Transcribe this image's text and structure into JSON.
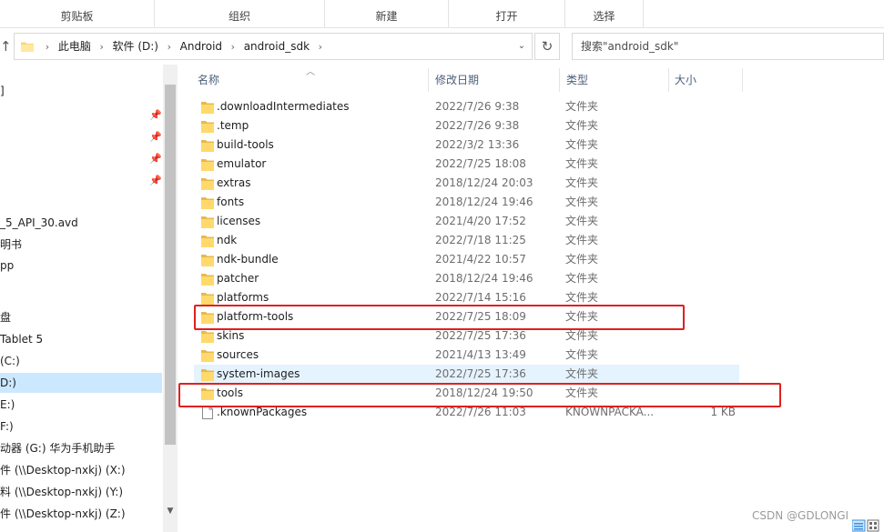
{
  "ribbon": {
    "groups": [
      "剪贴板",
      "组织",
      "新建",
      "打开",
      "选择"
    ]
  },
  "address": {
    "crumbs": [
      "此电脑",
      "软件 (D:)",
      "Android",
      "android_sdk"
    ],
    "search_placeholder": "搜索\"android_sdk\""
  },
  "nav": {
    "items": [
      "]",
      "_5_API_30.avd",
      "明书",
      "pp",
      "盘",
      " Tablet 5",
      " (C:)",
      "D:)",
      "E:)",
      "F:)",
      "动器 (G:) 华为手机助手",
      "件 (\\\\Desktop-nxkj) (X:)",
      "料 (\\\\Desktop-nxkj) (Y:)",
      "件 (\\\\Desktop-nxkj) (Z:)"
    ]
  },
  "columns": {
    "name": "名称",
    "date": "修改日期",
    "type": "类型",
    "size": "大小"
  },
  "files": [
    {
      "name": ".downloadIntermediates",
      "date": "2022/7/26 9:38",
      "type": "文件夹",
      "size": "",
      "icon": "folder-icon"
    },
    {
      "name": ".temp",
      "date": "2022/7/26 9:38",
      "type": "文件夹",
      "size": "",
      "icon": "folder-icon"
    },
    {
      "name": "build-tools",
      "date": "2022/3/2 13:36",
      "type": "文件夹",
      "size": "",
      "icon": "folder-icon"
    },
    {
      "name": "emulator",
      "date": "2022/7/25 18:08",
      "type": "文件夹",
      "size": "",
      "icon": "folder-icon"
    },
    {
      "name": "extras",
      "date": "2018/12/24 20:03",
      "type": "文件夹",
      "size": "",
      "icon": "folder-icon"
    },
    {
      "name": "fonts",
      "date": "2018/12/24 19:46",
      "type": "文件夹",
      "size": "",
      "icon": "folder-icon"
    },
    {
      "name": "licenses",
      "date": "2021/4/20 17:52",
      "type": "文件夹",
      "size": "",
      "icon": "folder-icon"
    },
    {
      "name": "ndk",
      "date": "2022/7/18 11:25",
      "type": "文件夹",
      "size": "",
      "icon": "folder-icon"
    },
    {
      "name": "ndk-bundle",
      "date": "2021/4/22 10:57",
      "type": "文件夹",
      "size": "",
      "icon": "folder-icon"
    },
    {
      "name": "patcher",
      "date": "2018/12/24 19:46",
      "type": "文件夹",
      "size": "",
      "icon": "folder-icon"
    },
    {
      "name": "platforms",
      "date": "2022/7/14 15:16",
      "type": "文件夹",
      "size": "",
      "icon": "folder-icon"
    },
    {
      "name": "platform-tools",
      "date": "2022/7/25 18:09",
      "type": "文件夹",
      "size": "",
      "icon": "folder-icon"
    },
    {
      "name": "skins",
      "date": "2022/7/25 17:36",
      "type": "文件夹",
      "size": "",
      "icon": "folder-icon"
    },
    {
      "name": "sources",
      "date": "2021/4/13 13:49",
      "type": "文件夹",
      "size": "",
      "icon": "folder-icon"
    },
    {
      "name": "system-images",
      "date": "2022/7/25 17:36",
      "type": "文件夹",
      "size": "",
      "icon": "folder-icon"
    },
    {
      "name": "tools",
      "date": "2018/12/24 19:50",
      "type": "文件夹",
      "size": "",
      "icon": "folder-icon"
    },
    {
      "name": ".knownPackages",
      "date": "2022/7/26 11:03",
      "type": "KNOWNPACKA...",
      "size": "1 KB",
      "icon": "file-icon"
    }
  ],
  "watermark": "CSDN @GDLONGI",
  "colors": {
    "annotation_red": "#e02020",
    "hover_row": "#e5f3ff",
    "selected_nav": "#cce8ff"
  }
}
